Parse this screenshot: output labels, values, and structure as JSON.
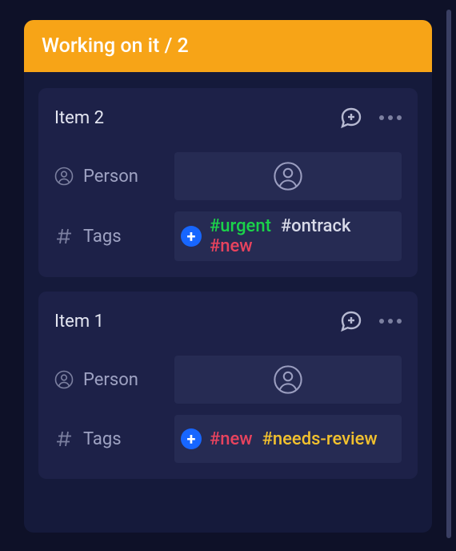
{
  "column": {
    "title": "Working on it / 2"
  },
  "labels": {
    "person": "Person",
    "tags": "Tags"
  },
  "cards": [
    {
      "title": "Item 2",
      "tags": [
        {
          "text": "#urgent",
          "cls": "tag-urgent"
        },
        {
          "text": "#ontrack",
          "cls": "tag-ontrack"
        },
        {
          "text": "#new",
          "cls": "tag-new"
        }
      ]
    },
    {
      "title": "Item 1",
      "tags": [
        {
          "text": "#new",
          "cls": "tag-new"
        },
        {
          "text": "#needs-review",
          "cls": "tag-needs-review"
        }
      ]
    }
  ]
}
